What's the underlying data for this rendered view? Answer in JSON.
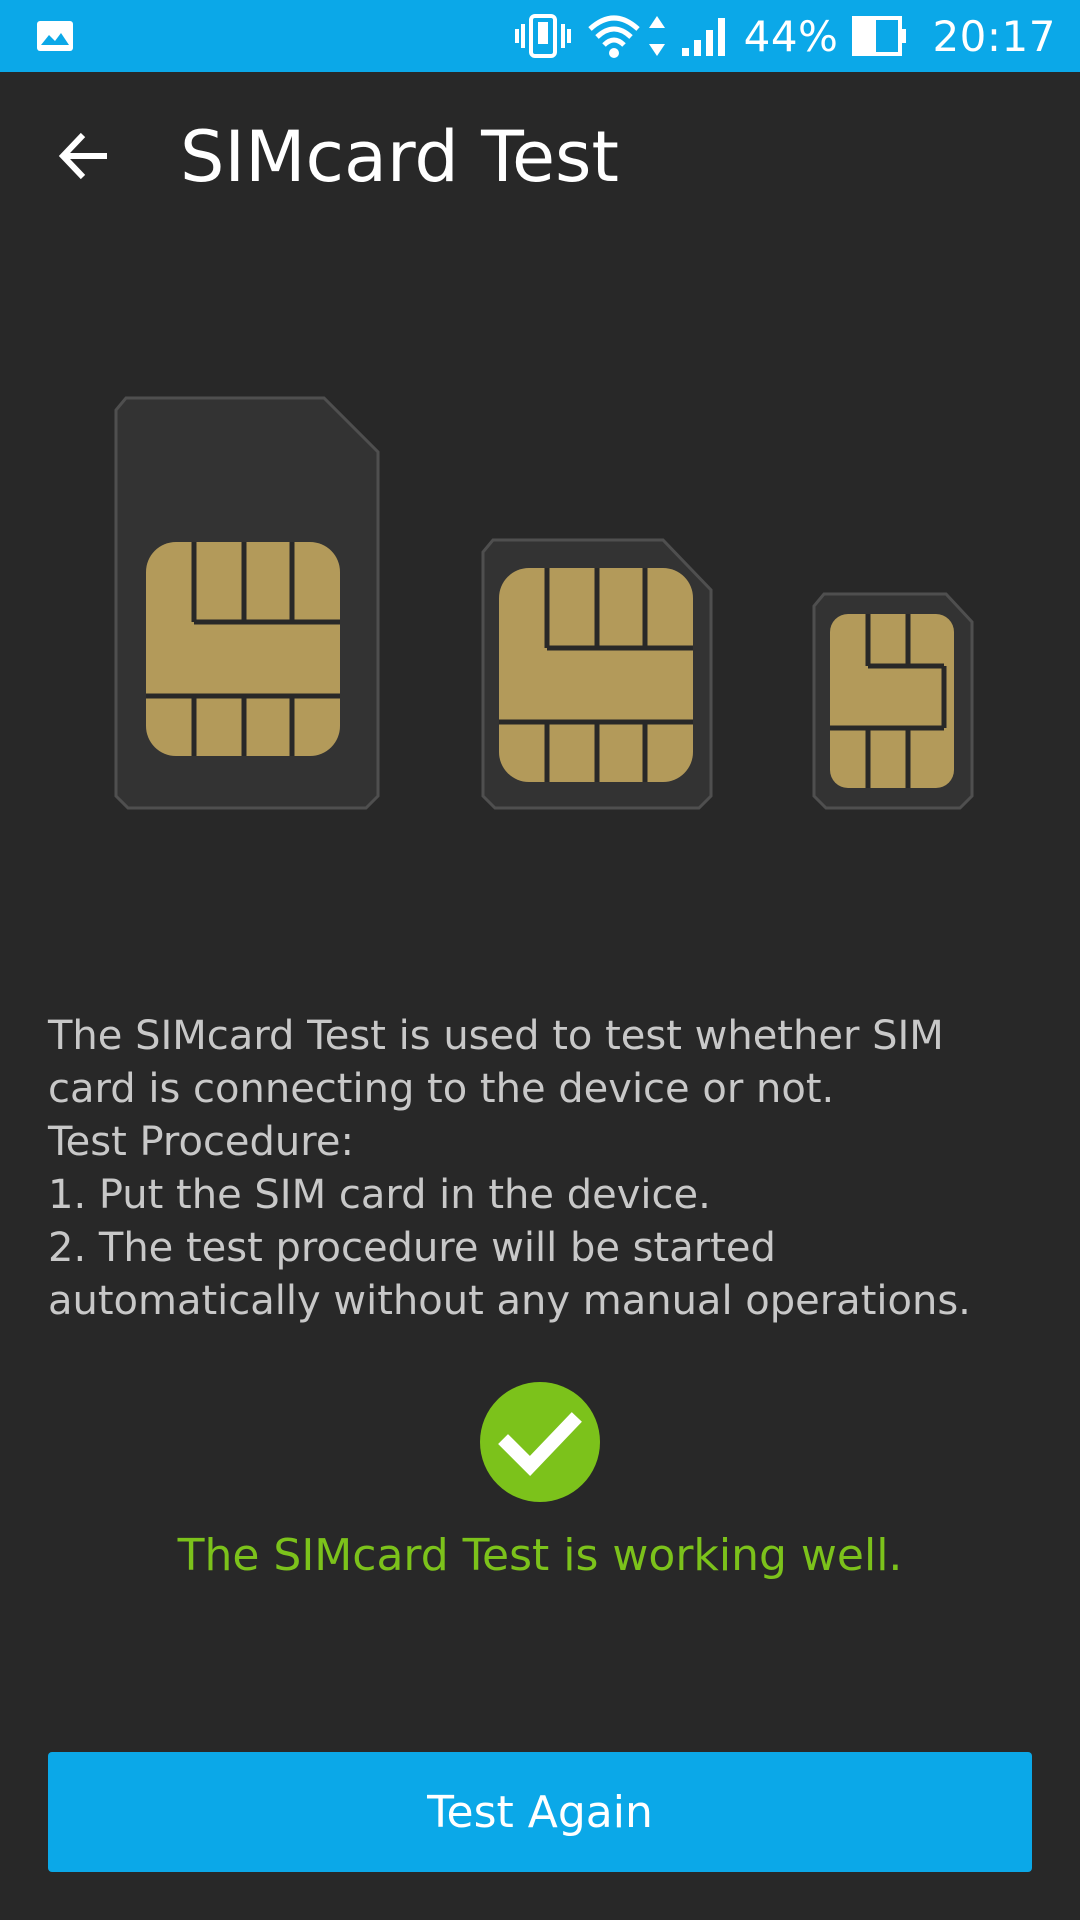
{
  "status_bar": {
    "battery_percent": "44%",
    "time": "20:17",
    "icons": [
      "gallery-icon",
      "vibrate-icon",
      "wifi-icon",
      "data-arrows-icon",
      "signal-icon",
      "battery-icon"
    ]
  },
  "app_bar": {
    "title": "SIMcard Test",
    "back_icon": "arrow-left-icon"
  },
  "illustration": {
    "cards": [
      "standard-sim",
      "micro-sim",
      "nano-sim"
    ]
  },
  "description": {
    "lines": [
      "The SIMcard Test is used to test whether SIM",
      "card is connecting to the device or not.",
      "Test Procedure:",
      "1. Put the SIM card in the device.",
      "2. The test procedure will be started",
      "automatically without any manual operations."
    ]
  },
  "result": {
    "icon": "check-circle-icon",
    "message": "The SIMcard Test is working well."
  },
  "actions": {
    "test_again_label": "Test Again"
  },
  "colors": {
    "accent": "#0ba8e8",
    "background": "#282828",
    "success": "#7cc21b",
    "chip_gold": "#b39a5a",
    "text": "#c8c8c8"
  }
}
